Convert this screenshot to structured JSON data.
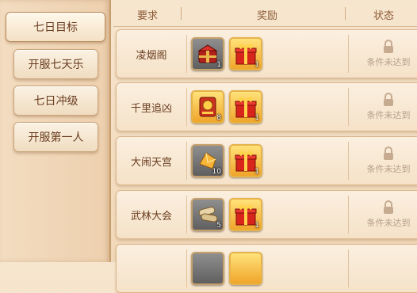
{
  "sidebar": {
    "items": [
      {
        "label": "七日目标"
      },
      {
        "label": "开服七天乐"
      },
      {
        "label": "七日冲级"
      },
      {
        "label": "开服第一人"
      }
    ]
  },
  "header": {
    "col_require": "要求",
    "col_reward": "奖励",
    "col_status": "状态"
  },
  "rows": [
    {
      "name": "凌烟阁",
      "rewards": [
        {
          "icon": "red-treasure-chest-icon",
          "count": "1"
        },
        {
          "icon": "gift-box-icon",
          "count": "1"
        }
      ],
      "status": "条件未达到"
    },
    {
      "name": "千里追凶",
      "rewards": [
        {
          "icon": "token-scroll-icon",
          "count": "8"
        },
        {
          "icon": "gift-box-icon",
          "count": "1"
        }
      ],
      "status": "条件未达到"
    },
    {
      "name": "大闹天宫",
      "rewards": [
        {
          "icon": "gold-crystal-icon",
          "count": "10"
        },
        {
          "icon": "gift-box-icon",
          "count": "1"
        }
      ],
      "status": "条件未达到"
    },
    {
      "name": "武林大会",
      "rewards": [
        {
          "icon": "scroll-bundle-icon",
          "count": "5"
        },
        {
          "icon": "gift-box-icon",
          "count": "1"
        }
      ],
      "status": "条件未达到"
    }
  ],
  "colors": {
    "text_brown": "#6a3d20",
    "status_gray": "#b7a08b",
    "frame_gold": "#c7a16b"
  }
}
